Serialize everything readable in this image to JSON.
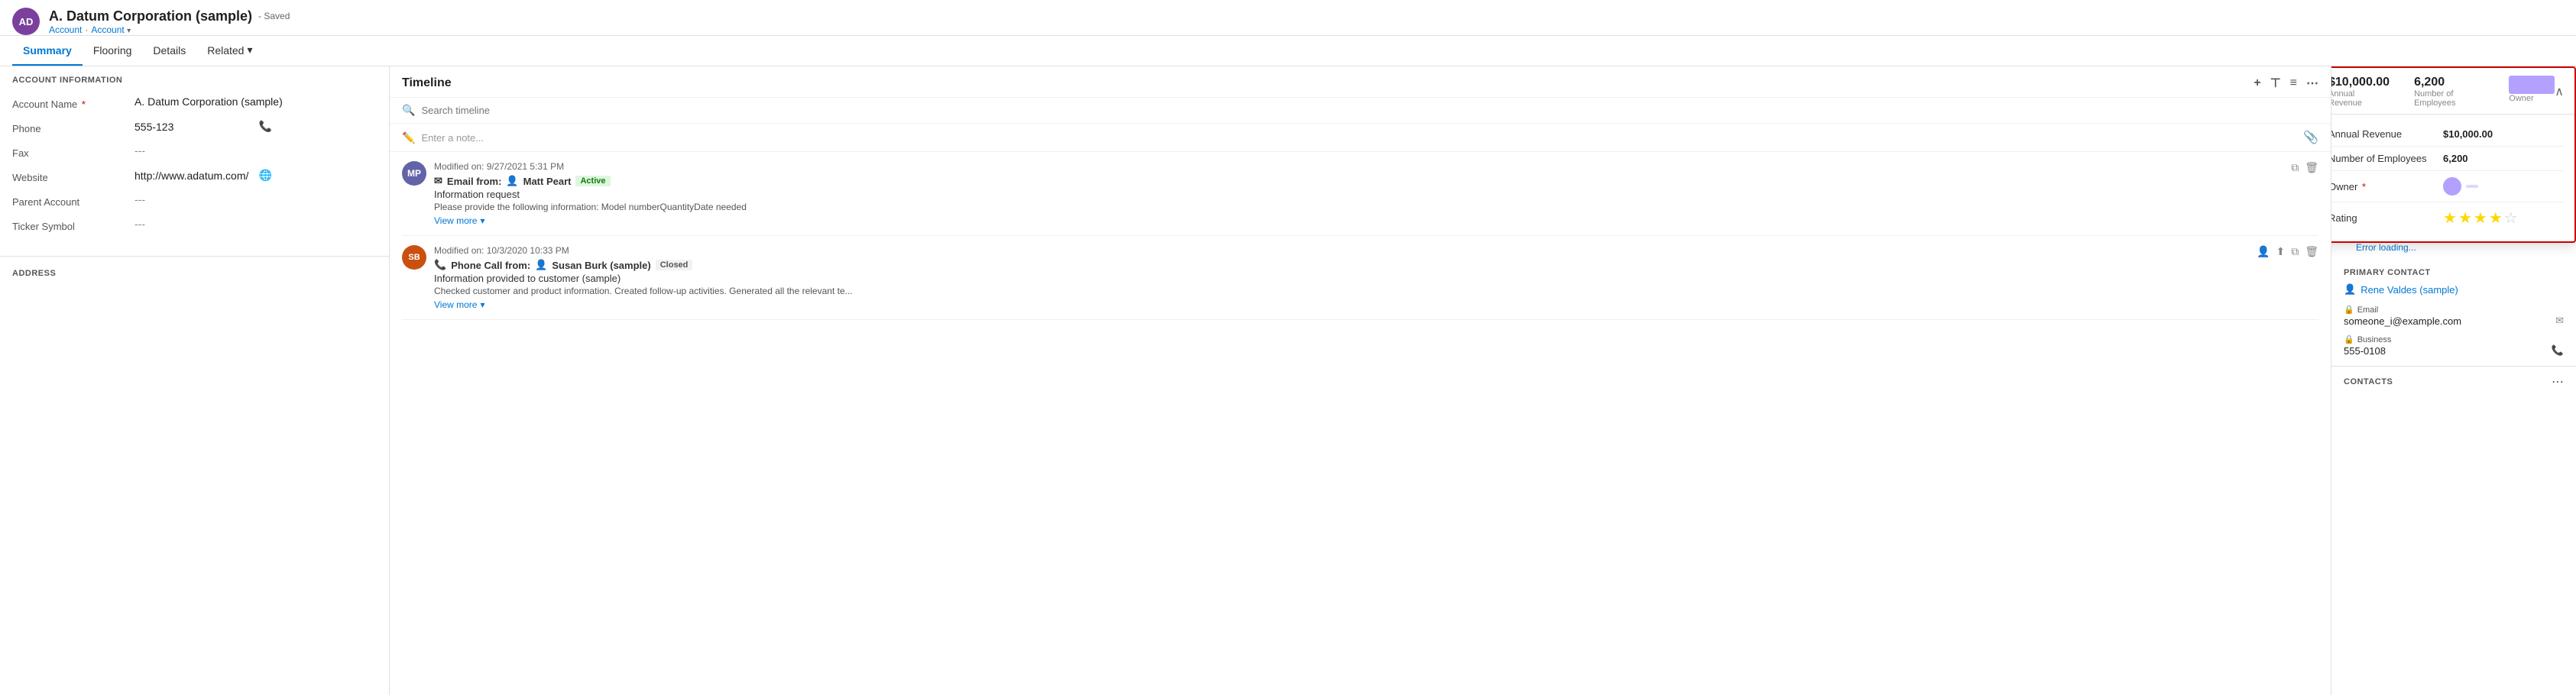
{
  "record": {
    "avatar_initials": "AD",
    "name": "A. Datum Corporation (sample)",
    "saved_label": "- Saved",
    "breadcrumb1": "Account",
    "breadcrumb2": "Account"
  },
  "tabs": {
    "items": [
      {
        "label": "Summary",
        "active": true
      },
      {
        "label": "Flooring",
        "active": false
      },
      {
        "label": "Details",
        "active": false
      },
      {
        "label": "Related",
        "active": false,
        "has_arrow": true
      }
    ]
  },
  "account_info": {
    "section_title": "ACCOUNT INFORMATION",
    "fields": [
      {
        "label": "Account Name",
        "required": true,
        "value": "A. Datum Corporation (sample)",
        "icon": null
      },
      {
        "label": "Phone",
        "required": false,
        "value": "555-123",
        "icon": "phone"
      },
      {
        "label": "Fax",
        "required": false,
        "value": "---",
        "icon": null
      },
      {
        "label": "Website",
        "required": false,
        "value": "http://www.adatum.com/",
        "icon": "globe"
      },
      {
        "label": "Parent Account",
        "required": false,
        "value": "---",
        "icon": null
      },
      {
        "label": "Ticker Symbol",
        "required": false,
        "value": "---",
        "icon": null
      }
    ]
  },
  "address": {
    "section_title": "ADDRESS"
  },
  "timeline": {
    "title": "Timeline",
    "search_placeholder": "Search timeline",
    "note_placeholder": "Enter a note...",
    "items": [
      {
        "id": 1,
        "avatar_initials": "MP",
        "avatar_color": "purple",
        "meta": "Modified on: 9/27/2021 5:31 PM",
        "type_icon": "email",
        "type_label": "Email from:",
        "person_icon": "user",
        "person": "Matt Peart",
        "status": "Active",
        "status_class": "active",
        "subject": "Information request",
        "detail": "Please provide the following information:  Model numberQuantityDate needed",
        "view_more": "View more"
      },
      {
        "id": 2,
        "avatar_initials": "SB",
        "avatar_color": "orange",
        "meta": "Modified on: 10/3/2020 10:33 PM",
        "type_icon": "phone",
        "type_label": "Phone Call from:",
        "person_icon": "user",
        "person": "Susan Burk (sample)",
        "status": "Closed",
        "status_class": "closed",
        "subject": "Information provided to customer (sample)",
        "detail": "Checked customer and product information. Created follow-up activities. Generated all the relevant te...",
        "view_more": "View more"
      }
    ]
  },
  "right_panel": {
    "error_loading": "Error loading...",
    "primary_contact_title": "Primary Contact",
    "primary_contact_name": "Rene Valdes (sample)",
    "email_label": "Email",
    "email_value": "someone_i@example.com",
    "business_label": "Business",
    "business_value": "555-0108",
    "contacts_title": "CONTACTS"
  },
  "popup": {
    "annual_revenue_label": "Annual Revenue",
    "annual_revenue_value": "$10,000.00",
    "employees_label": "Number of Employees",
    "employees_value": "6,200",
    "owner_label": "Owner",
    "rating_label": "Rating",
    "stars_filled": 4,
    "stars_total": 5,
    "header_revenue": "$10,000.00",
    "header_employees": "6,200",
    "header_revenue_label": "Annual Revenue",
    "header_employees_label": "Number of Employees",
    "header_owner_label": "Owner"
  }
}
